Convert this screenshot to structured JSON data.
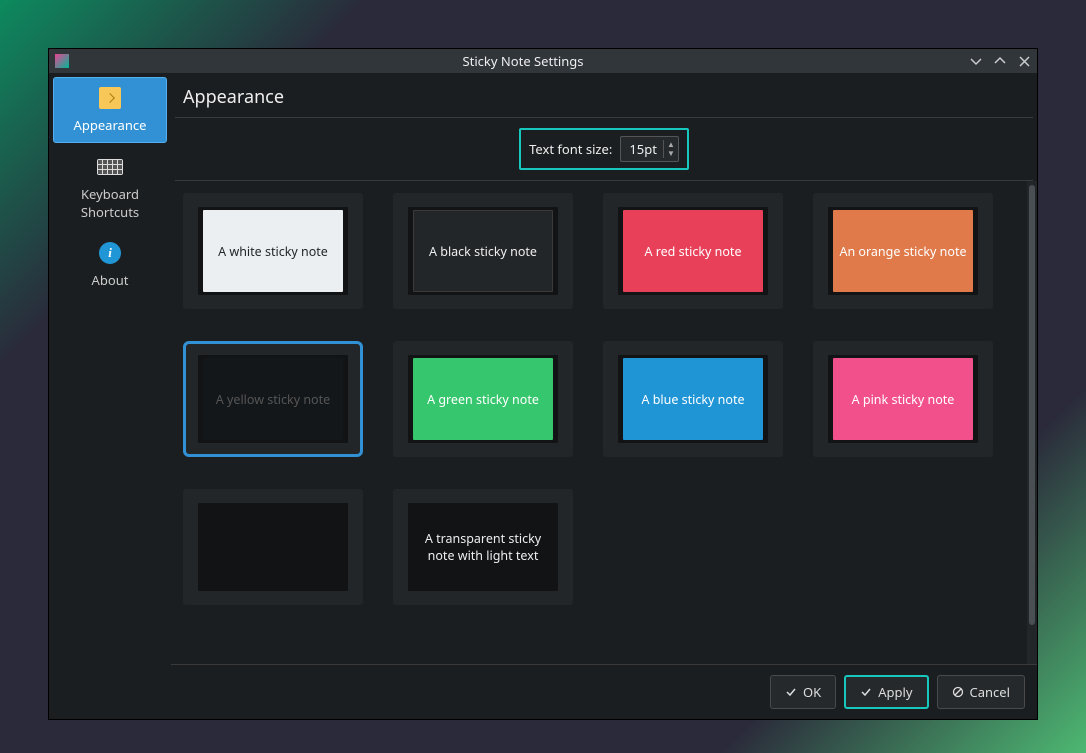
{
  "window": {
    "title": "Sticky Note Settings"
  },
  "sidebar": {
    "items": [
      {
        "label": "Appearance"
      },
      {
        "label": "Keyboard Shortcuts"
      },
      {
        "label": "About"
      }
    ]
  },
  "section": {
    "title": "Appearance"
  },
  "fontsize": {
    "label": "Text font size:",
    "value": "15pt"
  },
  "themes": [
    {
      "label": "A white sticky note",
      "cls": "sw-white"
    },
    {
      "label": "A black sticky note",
      "cls": "sw-black"
    },
    {
      "label": "A red sticky note",
      "cls": "sw-red"
    },
    {
      "label": "An orange sticky note",
      "cls": "sw-orange"
    },
    {
      "label": "A yellow sticky note",
      "cls": "sw-yellow",
      "selected": true
    },
    {
      "label": "A green sticky note",
      "cls": "sw-green"
    },
    {
      "label": "A blue sticky note",
      "cls": "sw-blue"
    },
    {
      "label": "A pink sticky note",
      "cls": "sw-pink"
    },
    {
      "label": "",
      "cls": "sw-trans-dark"
    },
    {
      "label": "A transparent sticky note with light text",
      "cls": "sw-trans-light"
    }
  ],
  "footer": {
    "ok": "OK",
    "apply": "Apply",
    "cancel": "Cancel"
  }
}
